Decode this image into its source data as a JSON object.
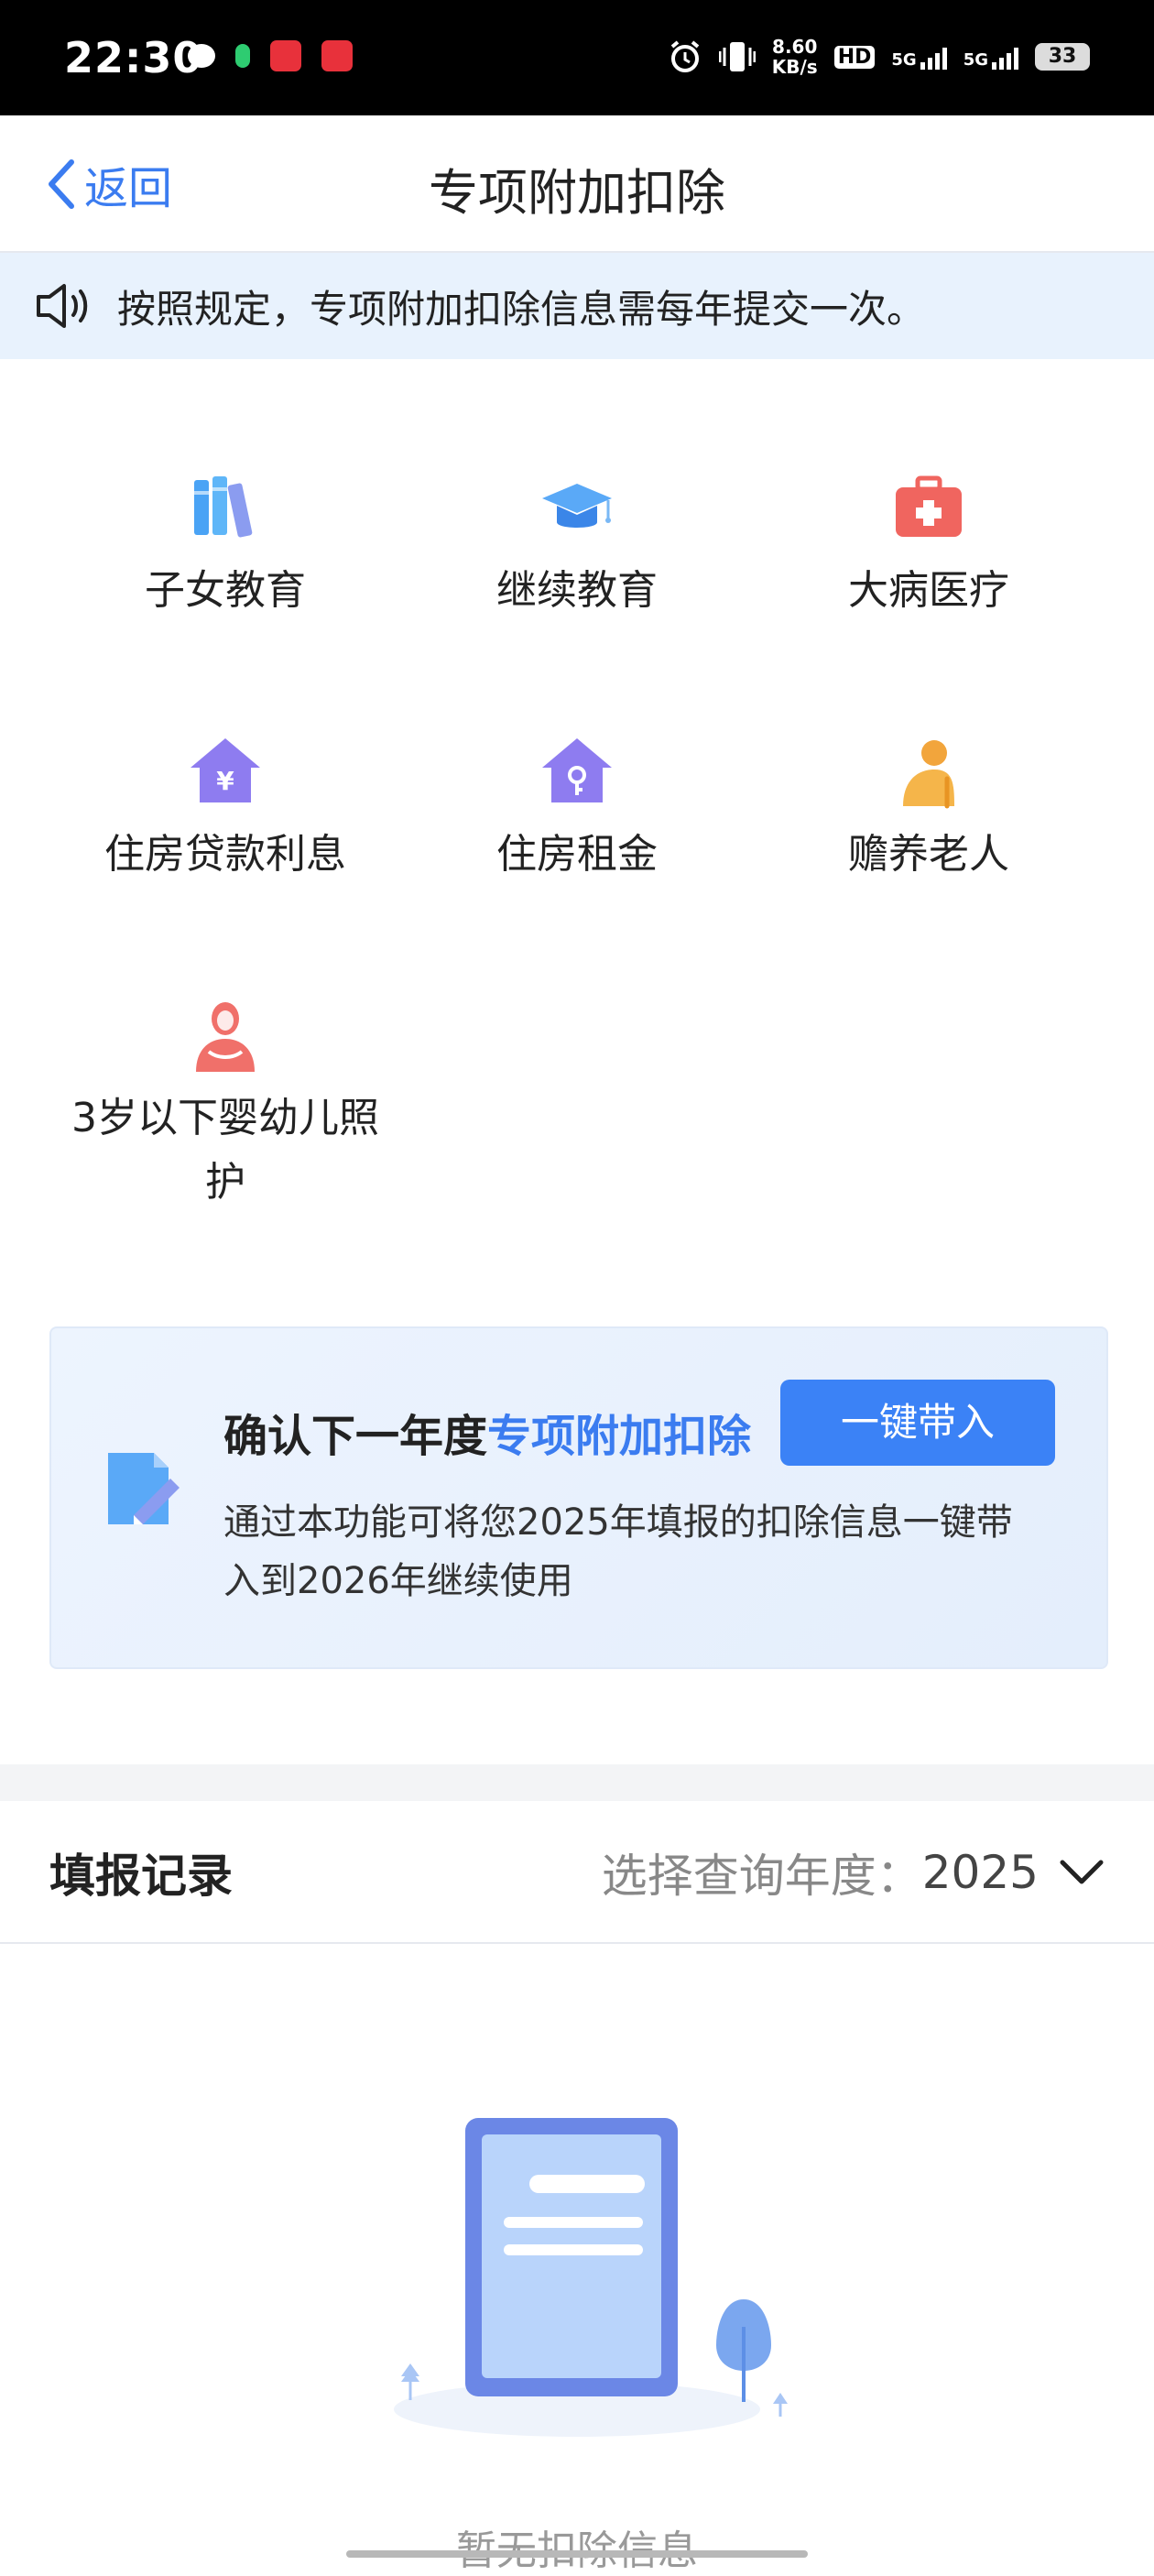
{
  "status_bar": {
    "time": "22:30",
    "speed_value": "8.60",
    "speed_unit": "KB/s",
    "hd": "HD",
    "net1": "5G",
    "net2": "5G",
    "battery": "33"
  },
  "header": {
    "back_label": "返回",
    "title": "专项附加扣除"
  },
  "notice": {
    "text": "按照规定，专项附加扣除信息需每年提交一次。"
  },
  "categories": [
    {
      "label": "子女教育",
      "icon": "books-icon"
    },
    {
      "label": "继续教育",
      "icon": "graduation-cap-icon"
    },
    {
      "label": "大病医疗",
      "icon": "medical-kit-icon"
    },
    {
      "label": "住房贷款利息",
      "icon": "house-yuan-icon"
    },
    {
      "label": "住房租金",
      "icon": "house-key-icon"
    },
    {
      "label": "赡养老人",
      "icon": "elderly-person-icon"
    },
    {
      "label": "3岁以下婴幼儿照护",
      "label_line1": "3岁以下婴幼儿照",
      "label_line2": "护",
      "icon": "mother-baby-icon"
    }
  ],
  "promo": {
    "title_prefix": "确认下一年度",
    "title_highlight": "专项附加扣除",
    "button": "一键带入",
    "desc": "通过本功能可将您2025年填报的扣除信息一键带入到2026年继续使用"
  },
  "records": {
    "title": "填报记录",
    "year_label": "选择查询年度：",
    "year_value": "2025",
    "empty_text": "暂无扣除信息"
  },
  "colors": {
    "accent": "#3b7cf0",
    "notice_bg": "#e8f2fd",
    "button_bg": "#3b82f6"
  }
}
